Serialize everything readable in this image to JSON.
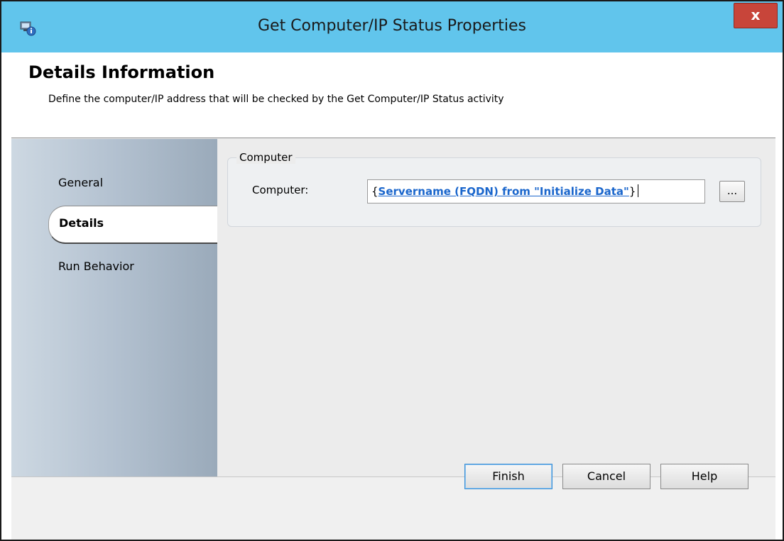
{
  "window": {
    "title": "Get Computer/IP Status Properties",
    "close_glyph": "x"
  },
  "header": {
    "title": "Details Information",
    "description": "Define the computer/IP address that will be checked by the Get Computer/IP Status activity"
  },
  "nav": {
    "items": [
      {
        "label": "General",
        "selected": false
      },
      {
        "label": "Details",
        "selected": true
      },
      {
        "label": "Run Behavior",
        "selected": false
      }
    ]
  },
  "group": {
    "title": "Computer",
    "field_label": "Computer:",
    "value_open": "{",
    "value_link": "Servername (FQDN) from \"Initialize Data\"",
    "value_close": "}",
    "browse_label": "..."
  },
  "buttons": {
    "finish": "Finish",
    "cancel": "Cancel",
    "help": "Help"
  },
  "colors": {
    "titlebar": "#61c5ec",
    "close_button": "#c8453a",
    "link": "#1a66cc"
  },
  "icons": {
    "app": "activity-properties-icon"
  }
}
